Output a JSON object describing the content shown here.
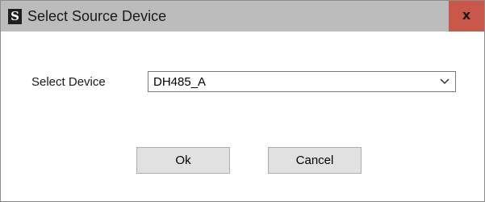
{
  "window": {
    "app_icon_glyph": "S",
    "title": "Select Source Device",
    "close_label": "x"
  },
  "form": {
    "device_label": "Select Device",
    "device_selected": "DH485_A"
  },
  "buttons": {
    "ok_label": "Ok",
    "cancel_label": "Cancel"
  },
  "colors": {
    "titlebar": "#bcbcbc",
    "close_button": "#c9584a",
    "button_face": "#e1e1e1"
  },
  "icons": {
    "app": "app-logo-icon",
    "dropdown": "chevron-down-icon"
  }
}
